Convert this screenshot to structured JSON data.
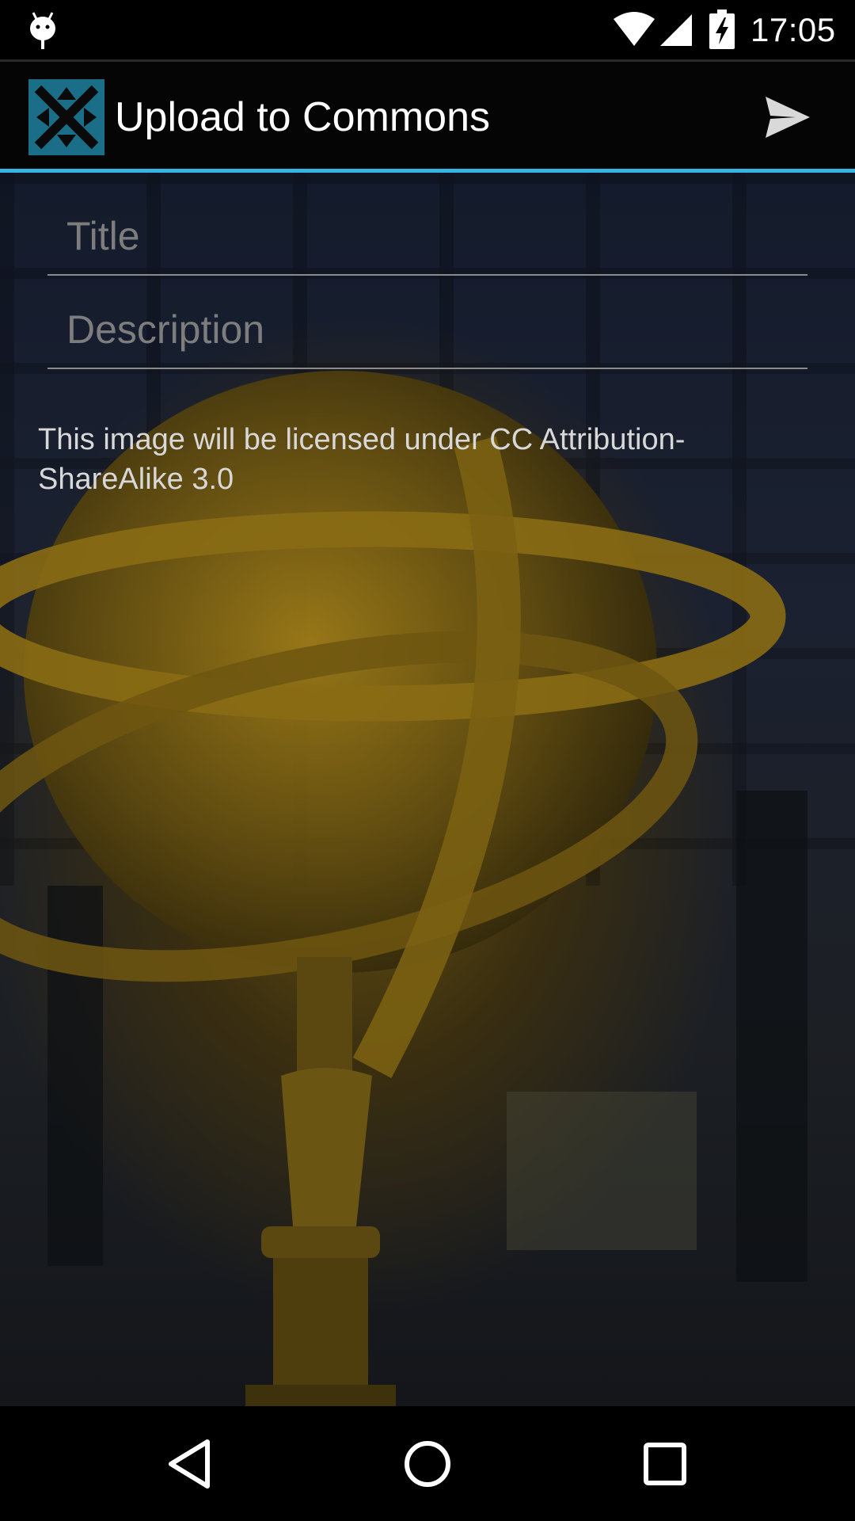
{
  "status_bar": {
    "time": "17:05",
    "icons": [
      "android-debug-icon",
      "wifi-icon",
      "signal-icon",
      "battery-charging-icon"
    ]
  },
  "action_bar": {
    "title": "Upload to Commons",
    "app_icon": "commons-logo-icon",
    "send_icon": "send-icon"
  },
  "form": {
    "title_placeholder": "Title",
    "title_value": "",
    "description_placeholder": "Description",
    "description_value": "",
    "license_text": "This image will be licensed under CC Attribution-ShareAlike 3.0"
  },
  "nav_bar": {
    "icons": [
      "back-icon",
      "home-icon",
      "recents-icon"
    ]
  },
  "colors": {
    "accent": "#33b5e5",
    "logo": "#1a6e87",
    "action_bar_bg": "#050505"
  }
}
